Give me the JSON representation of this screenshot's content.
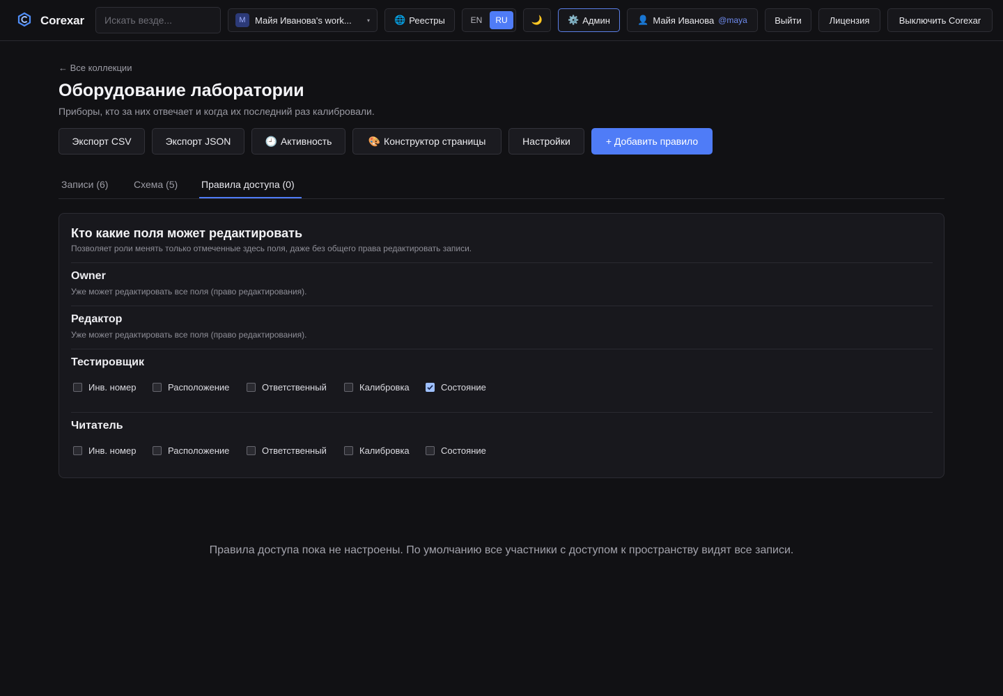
{
  "topbar": {
    "brand": "Corexar",
    "search_placeholder": "Искать везде...",
    "workspace": {
      "avatar": "M",
      "label": "Майя Иванова's work...",
      "caret": "▾"
    },
    "registries": {
      "icon": "globe-icon",
      "glyph": "🌐",
      "label": "Реестры"
    },
    "lang": {
      "en": "EN",
      "ru": "RU",
      "active": "RU"
    },
    "theme": {
      "icon": "moon-icon",
      "glyph": "🌙"
    },
    "admin": {
      "icon": "gear-icon",
      "glyph": "⚙️",
      "label": "Админ"
    },
    "user": {
      "icon": "user-icon",
      "glyph": "👤",
      "name": "Майя Иванова",
      "handle": "@maya"
    },
    "logout": "Выйти",
    "license": "Лицензия",
    "disable": "Выключить Corexar"
  },
  "header": {
    "back": "← Все коллекции",
    "title": "Оборудование лаборатории",
    "subtitle": "Приборы, кто за них отвечает и когда их последний раз калибровали."
  },
  "actions": {
    "export_csv": "Экспорт CSV",
    "export_json": "Экспорт JSON",
    "activity": {
      "icon": "clock-icon",
      "glyph": "🕘",
      "label": "Активность"
    },
    "page_builder": {
      "icon": "palette-icon",
      "glyph": "🎨",
      "label": "Конструктор страницы"
    },
    "settings": "Настройки",
    "add_rule": "+ Добавить правило"
  },
  "tabs": [
    {
      "label": "Записи (6)"
    },
    {
      "label": "Схема (5)"
    },
    {
      "label": "Правила доступа (0)",
      "active": true
    }
  ],
  "field_permissions": {
    "title": "Кто какие поля может редактировать",
    "description": "Позволяет роли менять только отмеченные здесь поля, даже без общего права редактировать записи.",
    "roles": [
      {
        "name": "Owner",
        "note": "Уже может редактировать все поля (право редактирования)."
      },
      {
        "name": "Редактор",
        "note": "Уже может редактировать все поля (право редактирования)."
      },
      {
        "name": "Тестировщик",
        "fields": [
          {
            "label": "Инв. номер",
            "checked": false
          },
          {
            "label": "Расположение",
            "checked": false
          },
          {
            "label": "Ответственный",
            "checked": false
          },
          {
            "label": "Калибровка",
            "checked": false
          },
          {
            "label": "Состояние",
            "checked": true
          }
        ]
      },
      {
        "name": "Читатель",
        "fields": [
          {
            "label": "Инв. номер",
            "checked": false
          },
          {
            "label": "Расположение",
            "checked": false
          },
          {
            "label": "Ответственный",
            "checked": false
          },
          {
            "label": "Калибровка",
            "checked": false
          },
          {
            "label": "Состояние",
            "checked": false
          }
        ]
      }
    ]
  },
  "empty_state": "Правила доступа пока не настроены. По умолчанию все участники с доступом к пространству видят все записи.",
  "colors": {
    "accent": "#4f7cf7",
    "background": "#111114",
    "card": "#18181d",
    "checked": "#9ec0ff"
  }
}
